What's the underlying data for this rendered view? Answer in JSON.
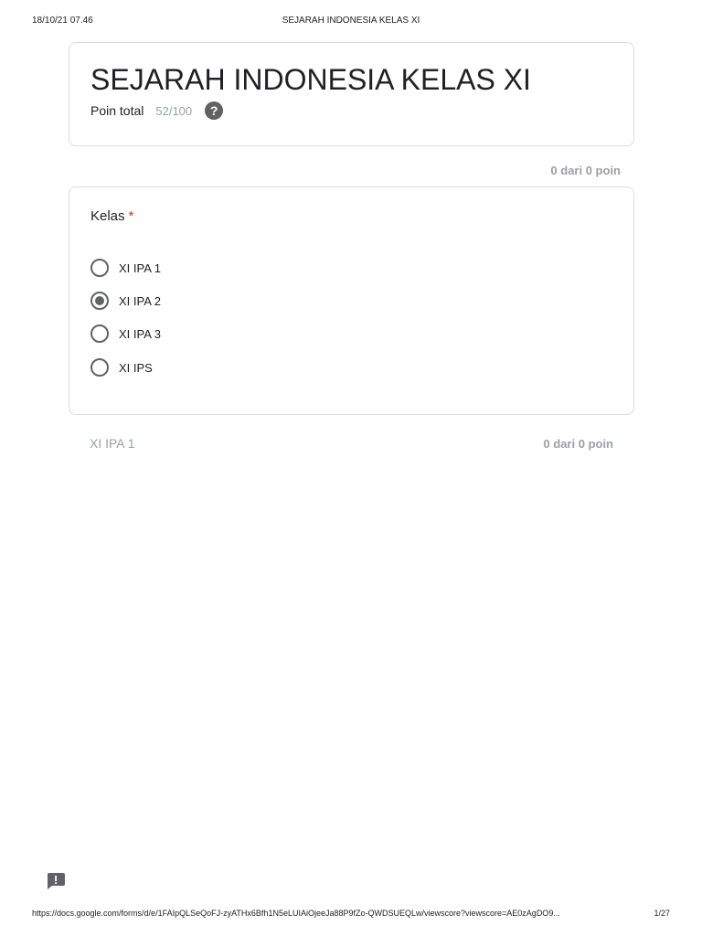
{
  "print_header": {
    "datetime": "18/10/21 07.46",
    "title": "SEJARAH INDONESIA KELAS XI"
  },
  "form": {
    "title": "SEJARAH INDONESIA KELAS XI",
    "total_points_label": "Poin total",
    "total_points_value": "52/100",
    "help_icon": "question-circle-icon"
  },
  "question": {
    "points": "0 dari 0 poin",
    "title": "Kelas",
    "required_marker": "*",
    "options": [
      {
        "label": "XI IPA 1",
        "selected": false
      },
      {
        "label": "XI IPA 2",
        "selected": true
      },
      {
        "label": "XI IPA 3",
        "selected": false
      },
      {
        "label": "XI IPS",
        "selected": false
      }
    ],
    "correct_answer": "XI IPA 1",
    "correct_answer_points": "0 dari 0 poin"
  },
  "feedback_icon": "feedback-icon",
  "print_footer": {
    "url": "https://docs.google.com/forms/d/e/1FAIpQLSeQoFJ-zyATHx6Bfh1N5eLUIAiOjeeJa88P9fZo-QWDSUEQLw/viewscore?viewscore=AE0zAgDO9...",
    "page": "1/27"
  },
  "colors": {
    "text": "#202124",
    "muted": "#9aa0a6",
    "border": "#dadce0",
    "required": "#d93025",
    "radio": "#5f6368"
  }
}
